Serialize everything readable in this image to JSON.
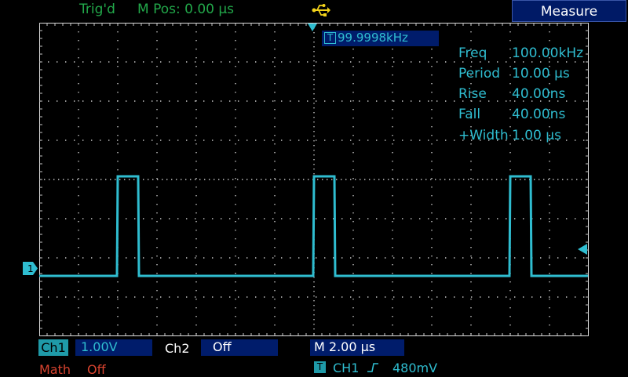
{
  "top_bar": {
    "trigger_status": "Trig'd",
    "horizontal_position": "M Pos: 0.00 µs",
    "usb_icon": "usb-icon",
    "menu_title": "Measure"
  },
  "readout": {
    "trigger_frequency": "99.9998kHz",
    "trigger_frequency_icon": "T",
    "measurements": [
      {
        "label": "Freq",
        "value": "100.00kHz"
      },
      {
        "label": "Period",
        "value": "10.00 µs"
      },
      {
        "label": "Rise",
        "value": "40.00ns"
      },
      {
        "label": "Fall",
        "value": "40.00ns"
      },
      {
        "label": "+Width",
        "value": "1.00 µs"
      }
    ]
  },
  "markers": {
    "ch1_ground": "1",
    "trigger_level": "trigger-level-arrow",
    "trigger_position": "trigger-position-arrow"
  },
  "bottom_bar": {
    "ch1_label": "Ch1",
    "ch1_scale": "1.00V",
    "ch2_label": "Ch2",
    "ch2_state": "Off",
    "timebase": "M 2.00 µs",
    "math_label": "Math",
    "math_state": "Off",
    "trigger_icon": "T",
    "trigger_source": "CH1",
    "trigger_edge_icon": "rising-edge-icon",
    "trigger_level": "480mV"
  },
  "colors": {
    "trace": "#2fbdd0",
    "status_green": "#22a84a",
    "menu_blue": "#001c6b",
    "math_red": "#d8432f"
  }
}
